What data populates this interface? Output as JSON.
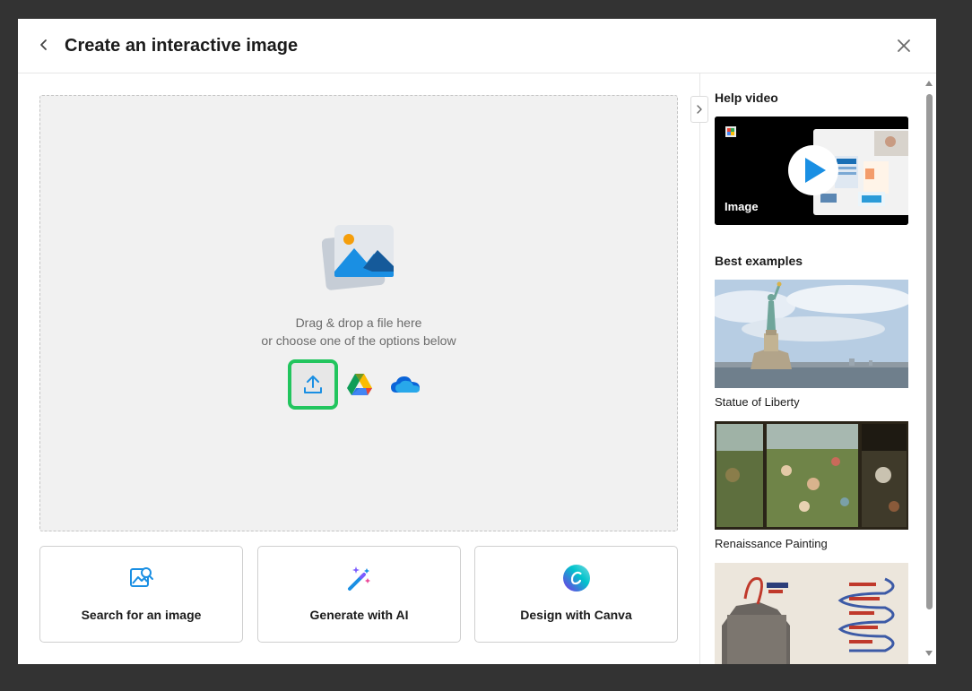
{
  "header": {
    "title": "Create an interactive image",
    "back_icon": "chevron-left-icon",
    "close_icon": "close-icon"
  },
  "dropzone": {
    "line1": "Drag & drop a file here",
    "line2": "or choose one of the options below",
    "illustration_icon": "image-placeholder-icon",
    "sources": [
      {
        "icon": "upload-icon",
        "highlight_color": "#22c55e"
      },
      {
        "icon": "google-drive-icon"
      },
      {
        "icon": "onedrive-icon"
      }
    ]
  },
  "options": [
    {
      "label": "Search for an image",
      "icon": "image-search-icon"
    },
    {
      "label": "Generate with AI",
      "icon": "magic-wand-icon"
    },
    {
      "label": "Design with Canva",
      "icon": "canva-icon"
    }
  ],
  "sidebar": {
    "help_title": "Help video",
    "video_label": "Image",
    "examples_title": "Best examples",
    "examples": [
      {
        "label": "Statue of Liberty"
      },
      {
        "label": "Renaissance Painting"
      },
      {
        "label": ""
      }
    ]
  },
  "colors": {
    "accent_blue": "#1a8fe3",
    "upload_highlight": "#22c55e"
  }
}
